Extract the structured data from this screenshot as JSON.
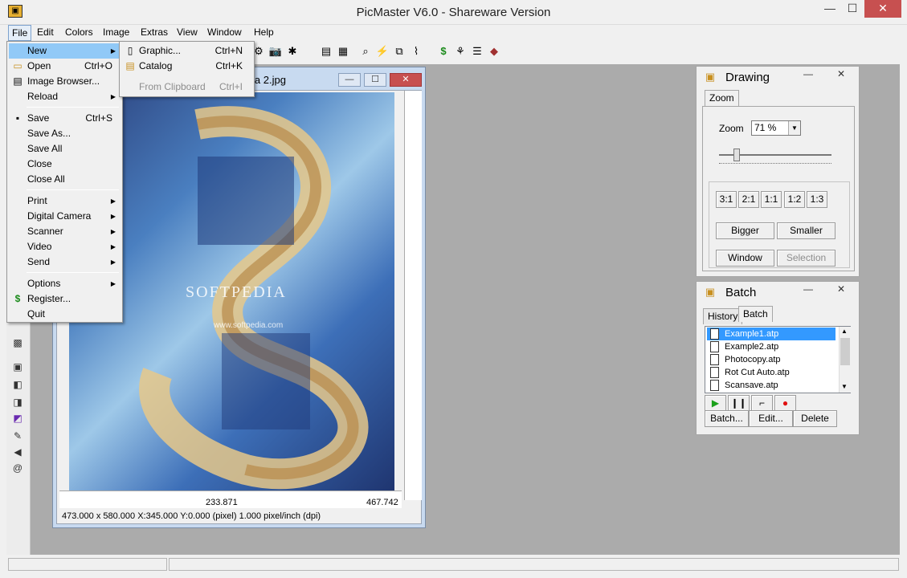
{
  "app": {
    "title": "PicMaster V6.0 - Shareware Version"
  },
  "window_controls": {
    "minimize": "—",
    "maximize": "☐",
    "close": "✕"
  },
  "menubar": [
    "File",
    "Edit",
    "Colors",
    "Image",
    "Extras",
    "View",
    "Window",
    "Help"
  ],
  "file_menu": {
    "items": [
      {
        "label": "New",
        "shortcut": "",
        "arrow": "▶"
      },
      {
        "label": "Open",
        "shortcut": "Ctrl+O",
        "arrow": ""
      },
      {
        "label": "Image Browser...",
        "shortcut": "",
        "arrow": ""
      },
      {
        "label": "Reload",
        "shortcut": "",
        "arrow": "▶"
      },
      {
        "label": "Save",
        "shortcut": "Ctrl+S",
        "arrow": ""
      },
      {
        "label": "Save As...",
        "shortcut": "",
        "arrow": ""
      },
      {
        "label": "Save All",
        "shortcut": "",
        "arrow": ""
      },
      {
        "label": "Close",
        "shortcut": "",
        "arrow": ""
      },
      {
        "label": "Close All",
        "shortcut": "",
        "arrow": ""
      },
      {
        "label": "Print",
        "shortcut": "",
        "arrow": "▶"
      },
      {
        "label": "Digital Camera",
        "shortcut": "",
        "arrow": "▶"
      },
      {
        "label": "Scanner",
        "shortcut": "",
        "arrow": "▶"
      },
      {
        "label": "Video",
        "shortcut": "",
        "arrow": "▶"
      },
      {
        "label": "Send",
        "shortcut": "",
        "arrow": "▶"
      },
      {
        "label": "Options",
        "shortcut": "",
        "arrow": "▶"
      },
      {
        "label": "Register...",
        "shortcut": "",
        "arrow": ""
      },
      {
        "label": "Quit",
        "shortcut": "",
        "arrow": ""
      }
    ]
  },
  "new_submenu": {
    "items": [
      {
        "label": "Graphic...",
        "shortcut": "Ctrl+N"
      },
      {
        "label": "Catalog",
        "shortcut": "Ctrl+K"
      },
      {
        "label": "From Clipboard",
        "shortcut": "Ctrl+I"
      }
    ]
  },
  "document": {
    "title": "ia 2.jpg",
    "watermark": "SOFTPEDIA",
    "watermark_url": "www.softpedia.com",
    "ruler_mid": "233.871",
    "ruler_end": "467.742",
    "status": "473.000 x 580.000    X:345.000  Y:0.000 (pixel)  1.000 pixel/inch (dpi)"
  },
  "drawing_panel": {
    "title": "Drawing",
    "tab": "Zoom",
    "zoom_label": "Zoom",
    "zoom_value": "71 %",
    "ratio_buttons": [
      "3:1",
      "2:1",
      "1:1",
      "1:2",
      "1:3"
    ],
    "bigger": "Bigger",
    "smaller": "Smaller",
    "window": "Window",
    "selection": "Selection"
  },
  "batch_panel": {
    "title": "Batch",
    "tabs": [
      "History",
      "Batch"
    ],
    "files": [
      "Example1.atp",
      "Example2.atp",
      "Photocopy.atp",
      "Rot Cut Auto.atp",
      "Scansave.atp"
    ],
    "batch_btn": "Batch...",
    "edit_btn": "Edit...",
    "delete_btn": "Delete"
  },
  "colors": {
    "accent": "#3399ff",
    "highlight": "#91c9f7",
    "close": "#c75050"
  }
}
